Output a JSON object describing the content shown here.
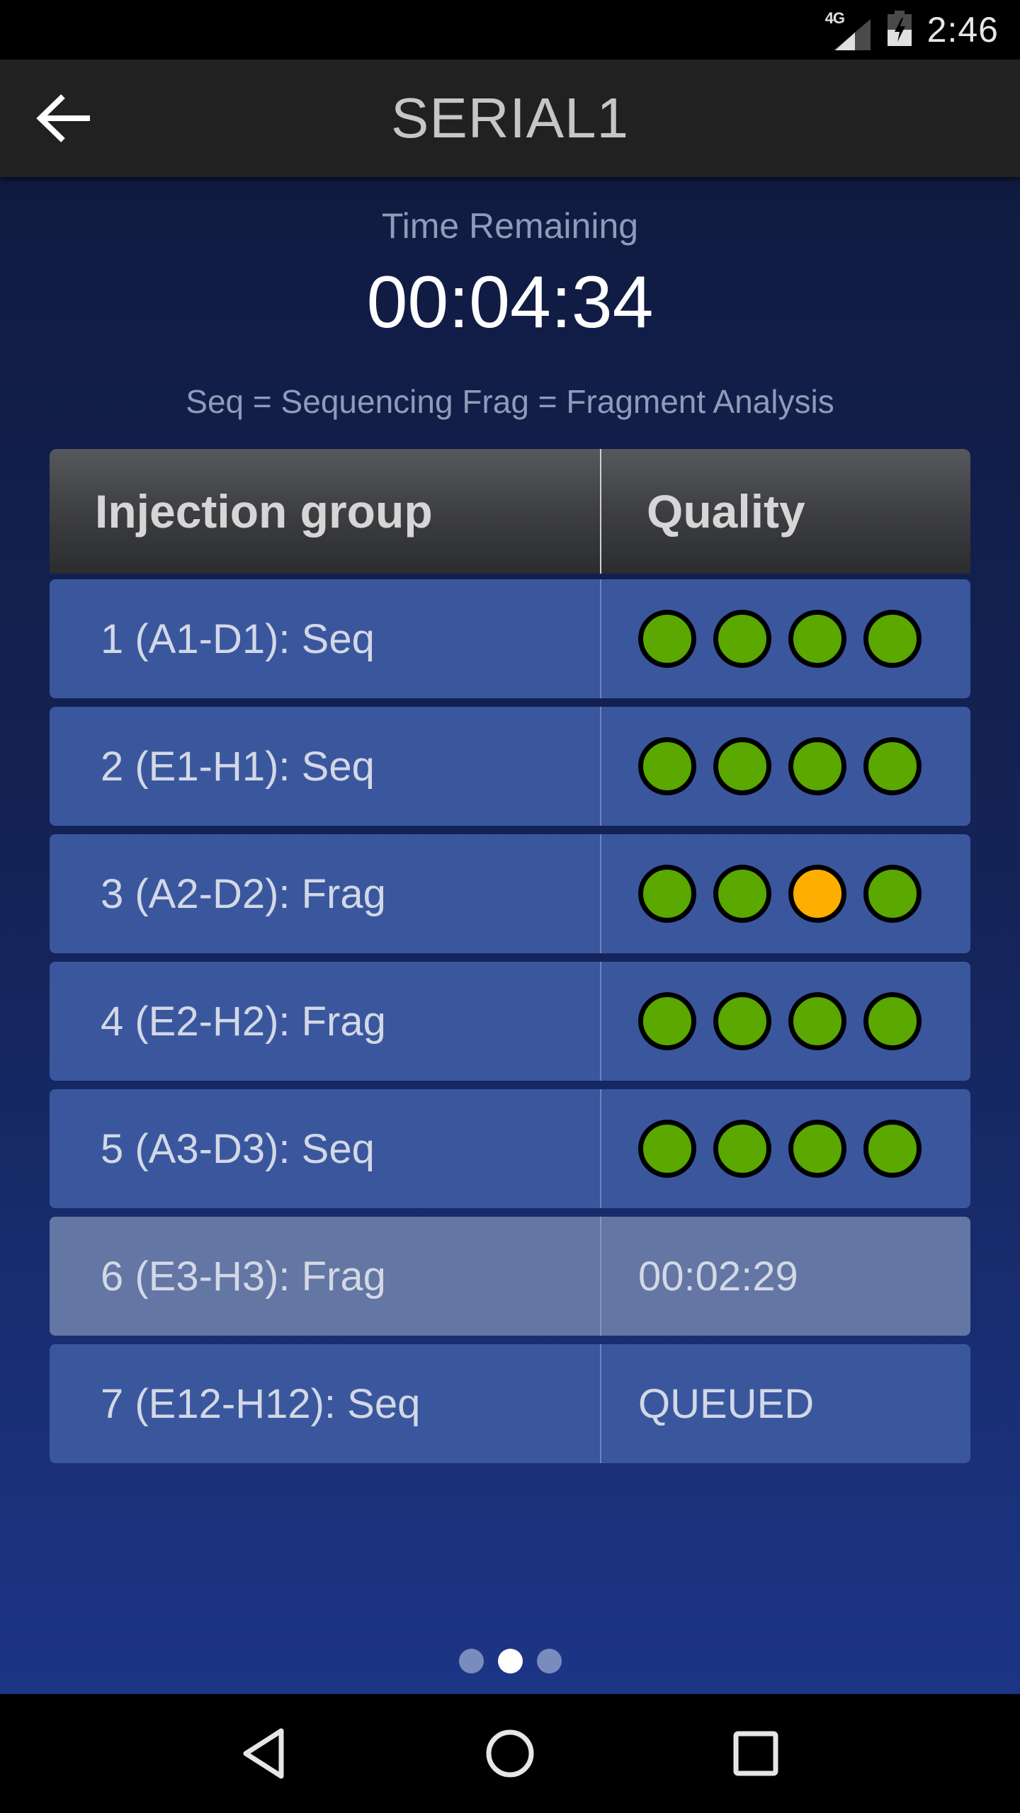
{
  "status_bar": {
    "network": "4G",
    "time": "2:46",
    "icons": [
      "signal-icon",
      "battery-charging-icon"
    ]
  },
  "app_bar": {
    "title": "SERIAL1",
    "back_icon": "arrow-left-icon"
  },
  "summary": {
    "time_label": "Time Remaining",
    "time_value": "00:04:34",
    "legend": "Seq = Sequencing Frag = Fragment Analysis"
  },
  "table": {
    "headers": {
      "group": "Injection group",
      "quality": "Quality"
    },
    "colors": {
      "good": "#5aa800",
      "warning": "#ffae00"
    },
    "rows": [
      {
        "group": "1 (A1-D1): Seq",
        "quality": [
          "good",
          "good",
          "good",
          "good"
        ],
        "status": ""
      },
      {
        "group": "2 (E1-H1): Seq",
        "quality": [
          "good",
          "good",
          "good",
          "good"
        ],
        "status": ""
      },
      {
        "group": "3 (A2-D2): Frag",
        "quality": [
          "good",
          "good",
          "warning",
          "good"
        ],
        "status": ""
      },
      {
        "group": "4 (E2-H2): Frag",
        "quality": [
          "good",
          "good",
          "good",
          "good"
        ],
        "status": ""
      },
      {
        "group": "5 (A3-D3): Seq",
        "quality": [
          "good",
          "good",
          "good",
          "good"
        ],
        "status": ""
      },
      {
        "group": "6 (E3-H3): Frag",
        "quality": [],
        "status": "00:02:29",
        "active": true
      },
      {
        "group": "7 (E12-H12): Seq",
        "quality": [],
        "status": "QUEUED"
      }
    ]
  },
  "pager": {
    "total": 3,
    "current": 2
  },
  "nav_bar": {
    "buttons": [
      "back-triangle-icon",
      "home-circle-icon",
      "recents-square-icon"
    ]
  }
}
